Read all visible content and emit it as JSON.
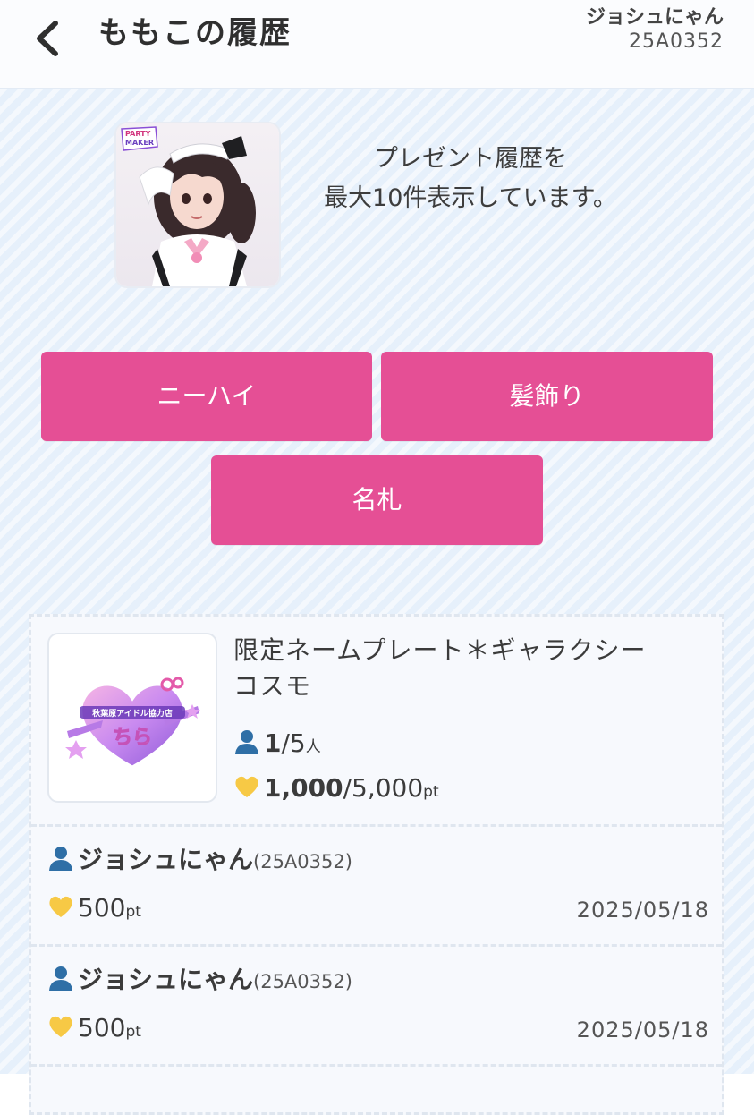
{
  "header": {
    "back_icon": "chevron-left-icon",
    "title": "ももこの履歴",
    "user_name": "ジョシュにゃん",
    "user_id": "25A0352"
  },
  "intro": {
    "line1": "プレゼント履歴を",
    "line2": "最大10件表示しています。",
    "photo_logo": "PARTY MAKER"
  },
  "categories": [
    {
      "label": "ニーハイ"
    },
    {
      "label": "髪飾り"
    },
    {
      "label": "名札"
    }
  ],
  "item": {
    "name_line1": "限定ネームプレート＊ギャラクシー",
    "name_line2": "コスモ",
    "supporters_current": "1",
    "supporters_total": "/5",
    "supporters_unit": "人",
    "points_current": "1,000",
    "points_total": "/5,000",
    "points_unit": "pt",
    "thumb_text": "ちら",
    "thumb_caption": "秋葉原アイドル協力店"
  },
  "entries": [
    {
      "name": "ジョシュにゃん",
      "id": "(25A0352)",
      "points": "500",
      "unit": "pt",
      "date": "2025/05/18"
    },
    {
      "name": "ジョシュにゃん",
      "id": "(25A0352)",
      "points": "500",
      "unit": "pt",
      "date": "2025/05/18"
    }
  ],
  "colors": {
    "accent": "#e54f95",
    "background": "#e6f0fb",
    "person_icon": "#2f6fa6",
    "heart_icon": "#f7c945"
  }
}
